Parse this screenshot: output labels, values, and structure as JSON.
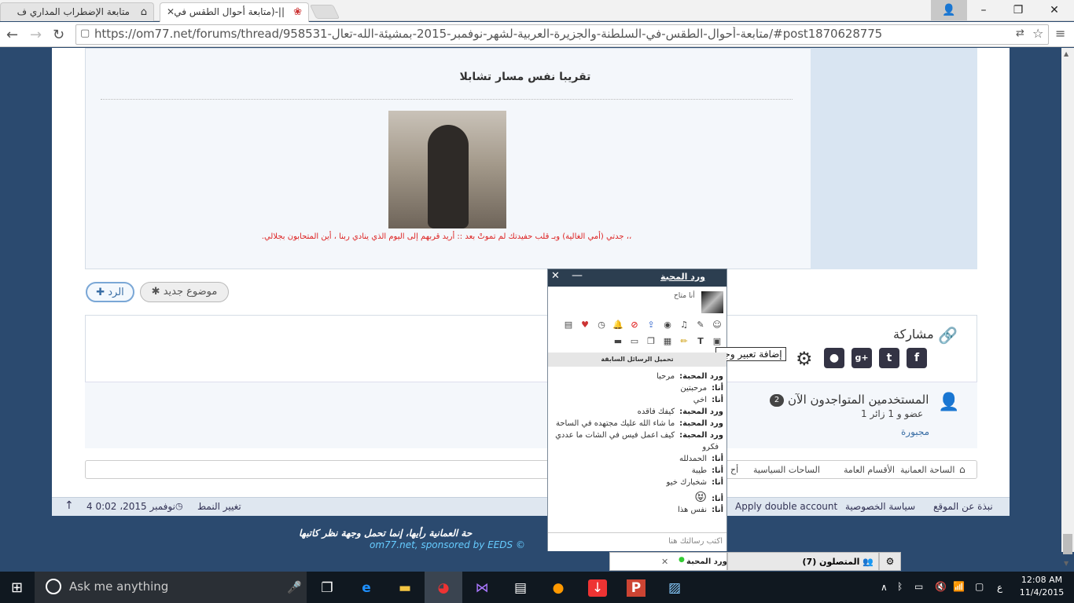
{
  "browser": {
    "tabs": [
      {
        "title": "متابعة الإضطراب المداري ف"
      },
      {
        "title": "||-(متابعة أحوال الطقس في"
      }
    ],
    "url": "https://om77.net/forums/thread/958531-متابعة-أحوال-الطقس-في-السلطنة-والجزيرة-العربية-لشهر-نوفمبر-2015-بمشيئة-الله-تعال/#post1870628775"
  },
  "post": {
    "title": "تقريبا نفس مسار تشابلا",
    "signature": "،، جدتي (أمي الغالية) وبـ قلب حفيدتك لم تموتْ بعد :: أريد قربهم إلى اليوم الذي ينادي ربنا ، أين المتحابون بجلالي."
  },
  "actions": {
    "reply": "الرد",
    "new_topic": "موضوع جديد"
  },
  "share": {
    "title": "مشاركة"
  },
  "online": {
    "title": "المستخدمين المتواجدون الآن",
    "count": "2",
    "summary": "1 عضو و 1 زائر",
    "members": "مجبورة"
  },
  "breadcrumb": [
    "الساحة العمانية",
    "الأقسام العامة",
    "الساحات السياسية",
    "أح"
  ],
  "footer": {
    "links": [
      "نبذة عن الموقع",
      "سياسة الخصوصية",
      "Apply double account"
    ],
    "style": "تغيير النمط",
    "datetime": "4 نوفمبر 2015، 0:02",
    "disclaimer": "حة العمانية رأيها، إنما تحمل وجهة نظر كاتبها",
    "sponsor": "om77.net, sponsored by EEDS ©"
  },
  "chat": {
    "name": "ورد المحبة",
    "status": "أنا متاح",
    "tooltip": "إضافة تعبير وجه",
    "load_prev": "تحميل الرسائل السابقة",
    "messages": [
      {
        "from": "ورد المحبة:",
        "text": "مرحبا"
      },
      {
        "from": "أنا:",
        "text": "مرحبتين"
      },
      {
        "from": "أنا:",
        "text": "اخي"
      },
      {
        "from": "ورد المحبة:",
        "text": "كيفك فاقده"
      },
      {
        "from": "ورد المحبة:",
        "text": "ما شاء الله عليك مجتهده في الساحة"
      },
      {
        "from": "ورد المحبة:",
        "text": "كيف اعمل فيس في الشات ما عددي"
      },
      {
        "from": "",
        "text": "فكرو"
      },
      {
        "from": "أنا:",
        "text": "الحمدلله"
      },
      {
        "from": "أنا:",
        "text": "طيبة"
      },
      {
        "from": "أنا:",
        "text": "شخبارك خيو"
      },
      {
        "from": "أنا:",
        "text": "😝"
      },
      {
        "from": "أنا:",
        "text": "نفس هذا"
      }
    ],
    "input_placeholder": "اكتب رسالتك هنا",
    "bar_contact": "ورد المحبة",
    "online_label": "المتصلون (7)"
  },
  "taskbar": {
    "search": "Ask me anything",
    "time": "12:08 AM",
    "date": "11/4/2015",
    "lang": "ع"
  }
}
